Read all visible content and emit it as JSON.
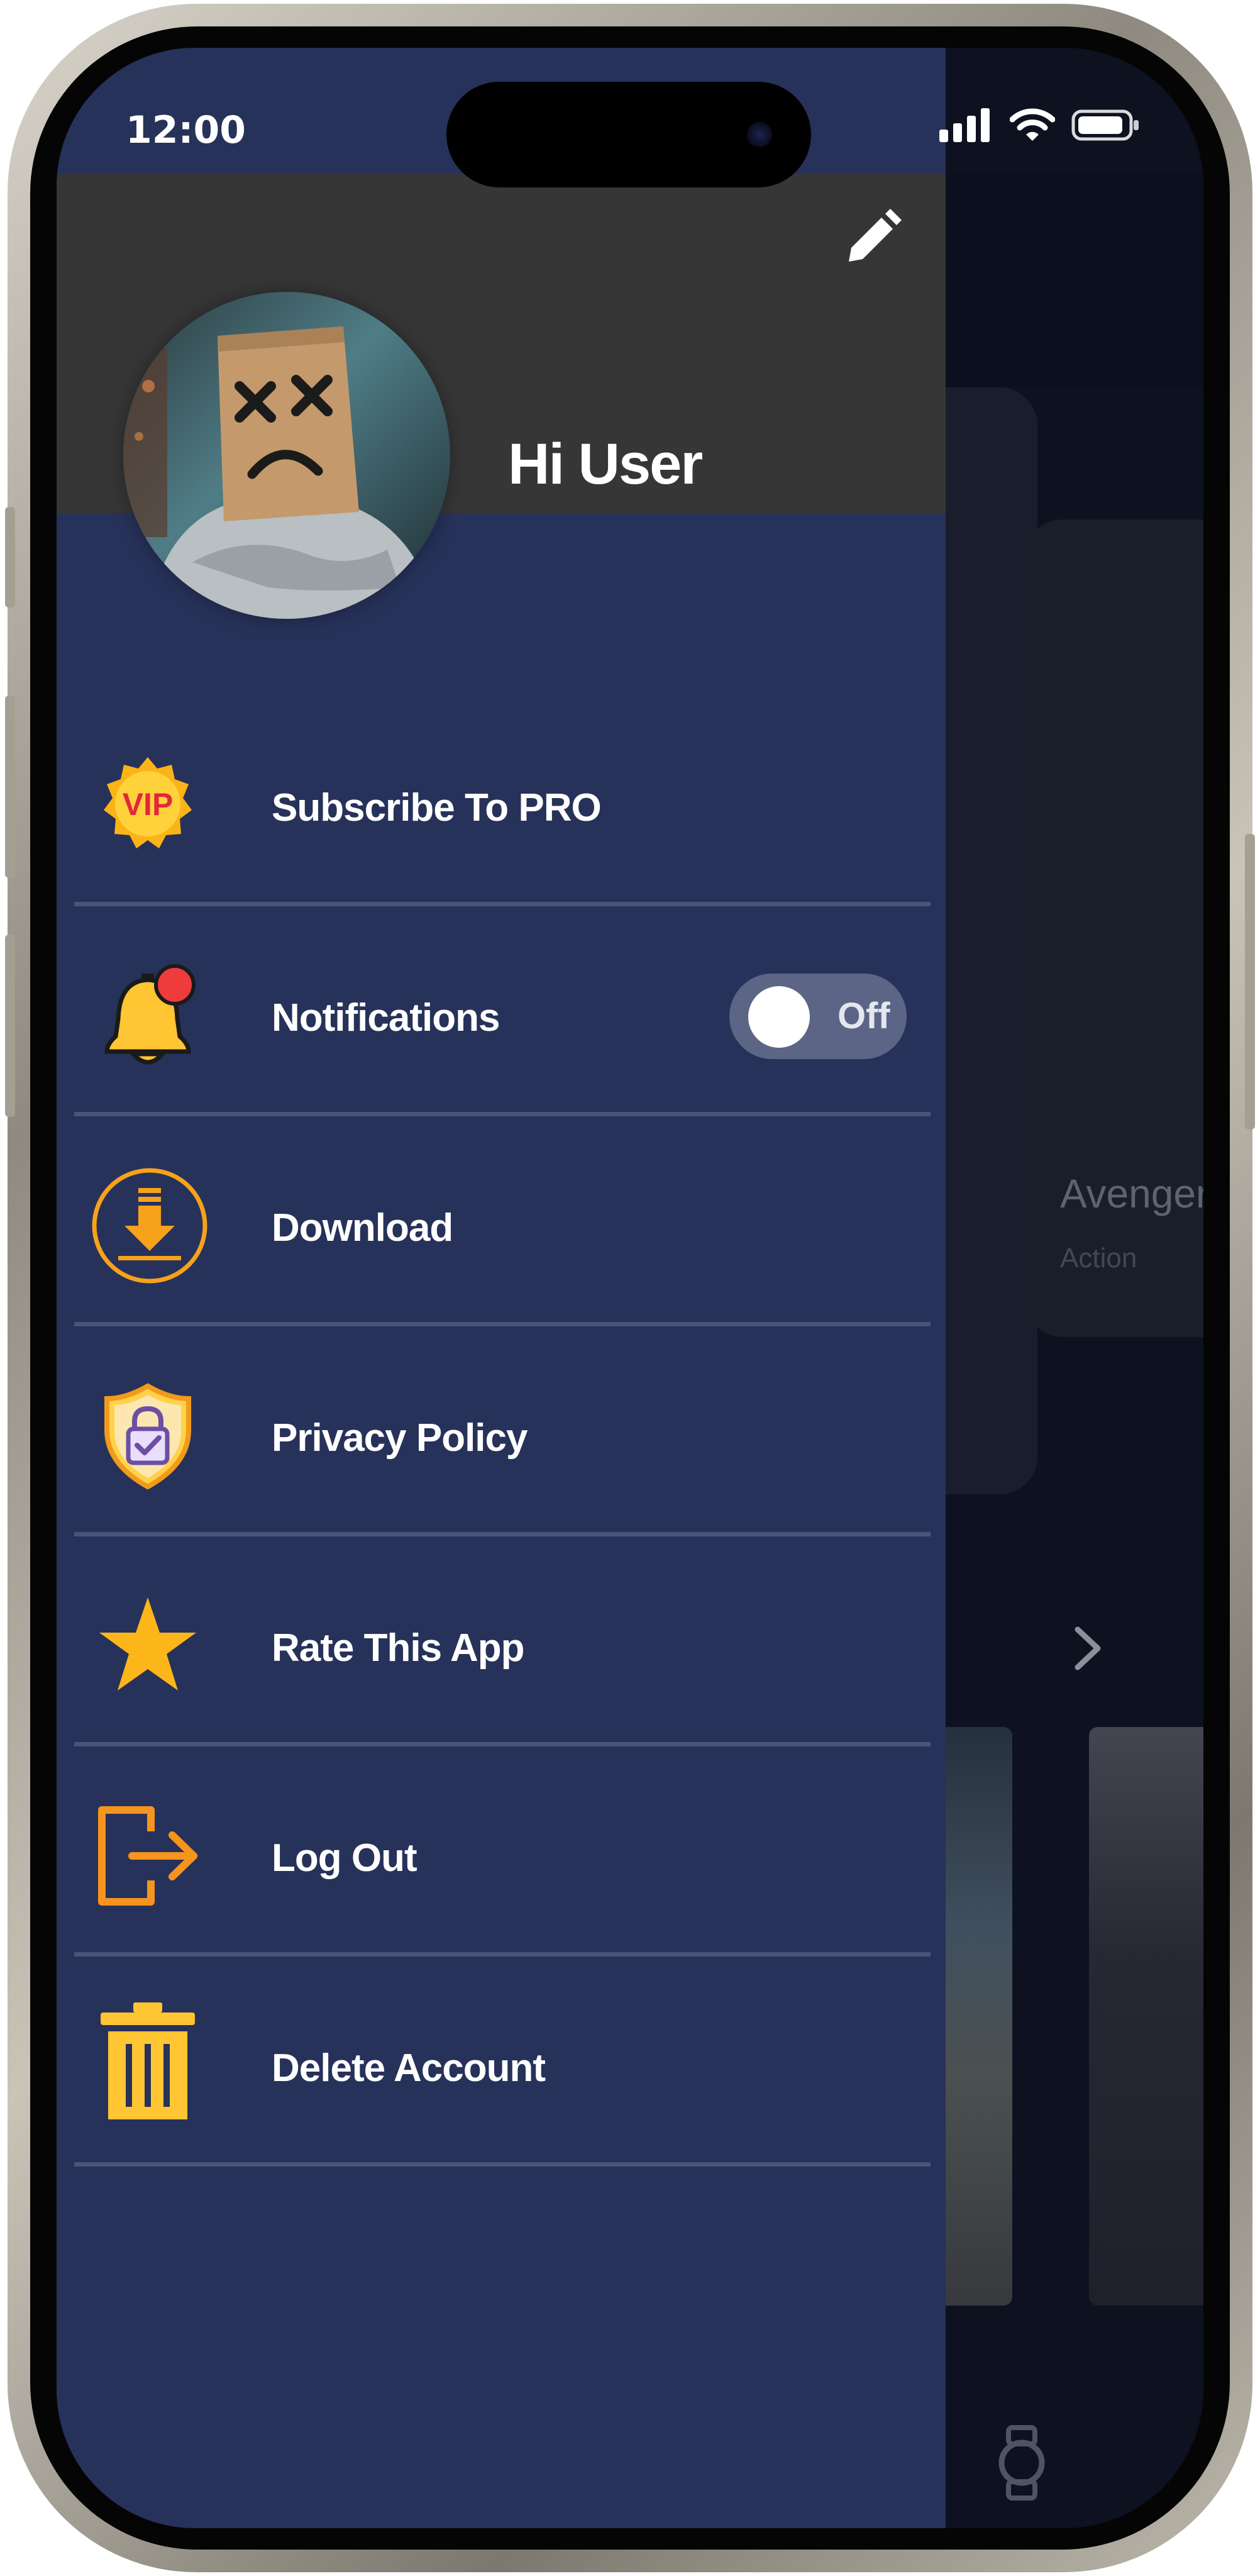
{
  "status_bar": {
    "time": "12:00",
    "icons": [
      "signal-icon",
      "wifi-icon",
      "battery-icon"
    ]
  },
  "drawer": {
    "greeting": "Hi User",
    "edit_icon": "pencil-icon",
    "header_color": "#363636",
    "background_color": "#27325a",
    "items": [
      {
        "label": "Subscribe To PRO",
        "icon": "vip-badge-icon",
        "icon_text": "VIP"
      },
      {
        "label": "Notifications",
        "icon": "bell-icon",
        "toggle": {
          "state": "Off",
          "on": false
        }
      },
      {
        "label": "Download",
        "icon": "download-icon"
      },
      {
        "label": "Privacy Policy",
        "icon": "shield-lock-icon"
      },
      {
        "label": "Rate This App",
        "icon": "star-icon"
      },
      {
        "label": "Log Out",
        "icon": "logout-icon"
      },
      {
        "label": "Delete Account",
        "icon": "trash-icon"
      }
    ]
  },
  "background": {
    "card_title": "Avengers",
    "card_genre": "Action"
  },
  "colors": {
    "accent_orange": "#f7a21b",
    "accent_yellow": "#ffc533"
  }
}
